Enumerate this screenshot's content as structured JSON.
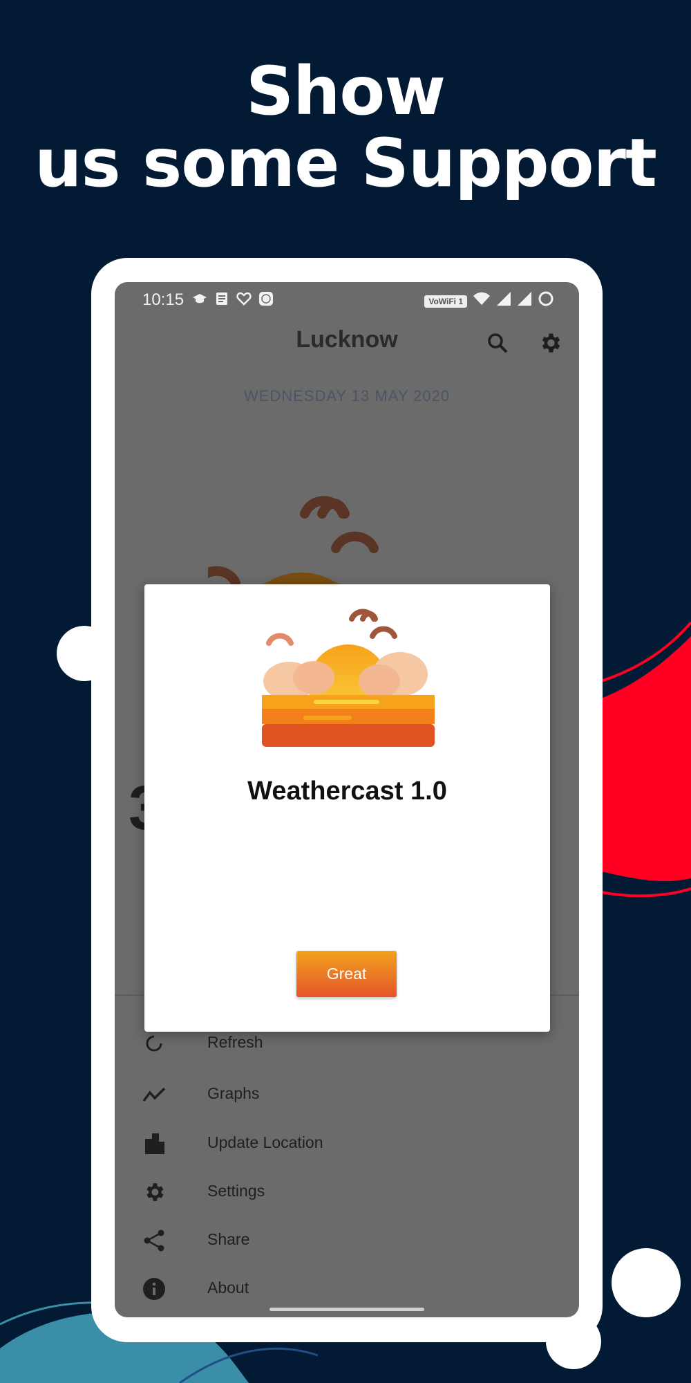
{
  "headline": {
    "line1": "Show",
    "line2": "us some Support"
  },
  "status_bar": {
    "time": "10:15",
    "network_badge": "VoWiFi 1"
  },
  "app_bar": {
    "city": "Lucknow"
  },
  "date": {
    "text": "WEDNESDAY  13  MAY  2020"
  },
  "background_fragments": {
    "temp_digit": "3"
  },
  "drawer": {
    "items": [
      {
        "label": "Refresh",
        "icon": "refresh-icon"
      },
      {
        "label": "Graphs",
        "icon": "graph-icon"
      },
      {
        "label": "Update Location",
        "icon": "city-icon"
      },
      {
        "label": "Settings",
        "icon": "gear-icon"
      },
      {
        "label": "Share",
        "icon": "share-icon"
      },
      {
        "label": "About",
        "icon": "info-icon"
      }
    ]
  },
  "dialog": {
    "title": "Weathercast 1.0",
    "button_label": "Great"
  },
  "colors": {
    "page_background": "#031a35",
    "accent_red": "#ff0022",
    "accent_teal": "#3b8ea8",
    "button_top": "#f2a21e",
    "button_bottom": "#e4552a"
  }
}
